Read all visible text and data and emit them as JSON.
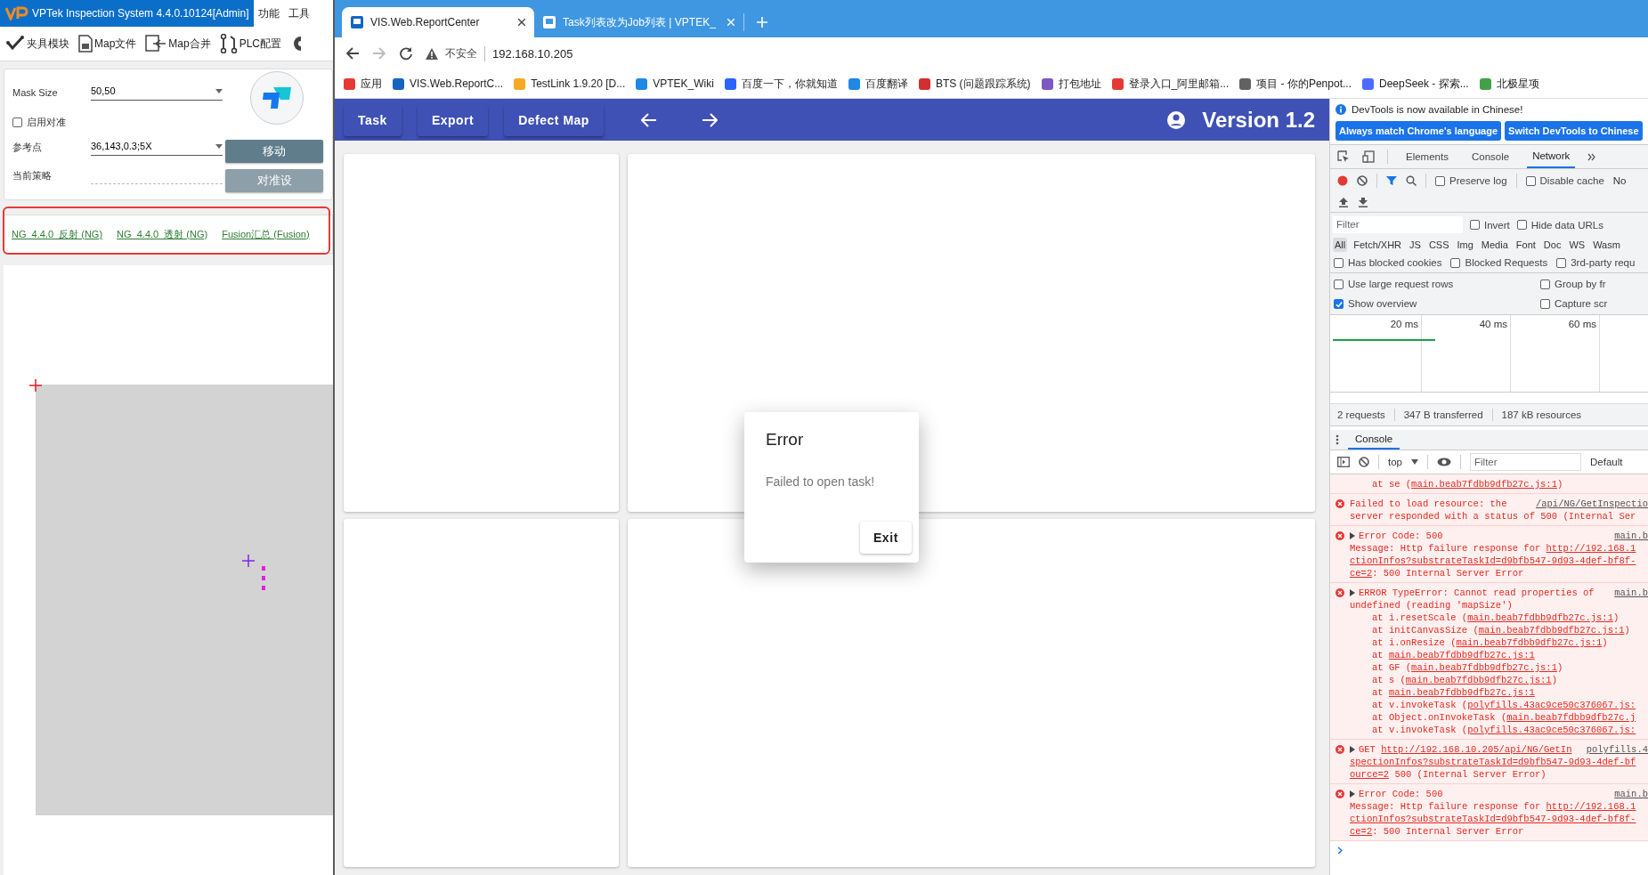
{
  "vptek_window": {
    "title": "VPTek Inspection System 4.4.0.10124[Admin]",
    "menu": [
      "功能",
      "工具"
    ],
    "toolbar": [
      "夹具模块",
      "Map文件",
      "Map合并",
      "PLC配置"
    ],
    "form": {
      "mask_size": {
        "label": "Mask Size",
        "value": "50,50"
      },
      "align": {
        "label": "启用对准",
        "checked": false
      },
      "reference": {
        "label": "参考点",
        "value": "36,143,0.3;5X"
      },
      "move_button": "移动",
      "strategy": {
        "label": "当前策略"
      },
      "align_settings": {
        "label": "对准设",
        "disabled": true
      }
    },
    "recipe_links": [
      "NG_4.4.0_反射 (NG)",
      "NG_4.4.0_透射 (NG)",
      "Fusion汇总 (Fusion)"
    ]
  },
  "browser": {
    "tabs": [
      {
        "title": "VIS.Web.ReportCenter",
        "selected": true
      },
      {
        "title": "Task列表改为Job列表 | VPTEK_",
        "selected": false
      }
    ],
    "security": "不安全",
    "url": "192.168.10.205",
    "bookmarks": [
      "应用",
      "VIS.Web.ReportC...",
      "TestLink 1.9.20 [D...",
      "VPTEK_Wiki",
      "百度一下，你就知道",
      "百度翻译",
      "BTS (问题跟踪系统)",
      "打包地址",
      "登录入口_阿里邮箱...",
      "项目 - 你的Penpot...",
      "DeepSeek - 探索...",
      "北极星项"
    ]
  },
  "report_center": {
    "nav": [
      "Task",
      "Export",
      "Defect Map"
    ],
    "version": "Version 1.2",
    "dialog": {
      "title": "Error",
      "message": "Failed to open task!",
      "button": "Exit"
    }
  },
  "devtools": {
    "notice": "DevTools is now available in Chinese!",
    "notice_buttons": [
      "Always match Chrome's language",
      "Switch DevTools to Chinese"
    ],
    "panels": [
      {
        "label": "Elements",
        "selected": false
      },
      {
        "label": "Console",
        "selected": false
      },
      {
        "label": "Network",
        "selected": true
      }
    ],
    "network": {
      "recording": true,
      "options": [
        {
          "label": "Preserve log",
          "checked": false
        },
        {
          "label": "Disable cache",
          "checked": false
        }
      ],
      "throttle": "No",
      "filter": {
        "placeholder": "Filter"
      },
      "filter_options": [
        {
          "label": "Invert",
          "checked": false
        },
        {
          "label": "Hide data URLs",
          "checked": false
        }
      ],
      "types": [
        {
          "label": "All",
          "selected": true
        },
        {
          "label": "Fetch/XHR",
          "selected": false
        },
        {
          "label": "JS",
          "selected": false
        },
        {
          "label": "CSS",
          "selected": false
        },
        {
          "label": "Img",
          "selected": false
        },
        {
          "label": "Media",
          "selected": false
        },
        {
          "label": "Font",
          "selected": false
        },
        {
          "label": "Doc",
          "selected": false
        },
        {
          "label": "WS",
          "selected": false
        },
        {
          "label": "Wasm",
          "selected": false
        }
      ],
      "blocked_options": [
        {
          "label": "Has blocked cookies",
          "checked": false
        },
        {
          "label": "Blocked Requests",
          "checked": false
        },
        {
          "label": "3rd-party requ",
          "checked": false
        }
      ],
      "settings": [
        {
          "label": "Use large request rows",
          "checked": false
        },
        {
          "label": "Group by fr",
          "checked": false
        },
        {
          "label": "Show overview",
          "checked": true
        },
        {
          "label": "Capture scr",
          "checked": false
        }
      ],
      "overview_ticks": [
        "20 ms",
        "40 ms",
        "60 ms"
      ],
      "summary": [
        "2 requests",
        "347 B transferred",
        "187 kB resources"
      ]
    },
    "drawer": {
      "tab": "Console",
      "context": "top",
      "filter": {
        "placeholder": "Filter"
      },
      "levels": "Default",
      "messages": [
        {
          "kind": "trace",
          "expandable": false,
          "lines": [
            {
              "indent": true,
              "parts": [
                {
                  "text": "at se (",
                  "link": false
                },
                {
                  "text": "main.beab7fdbb9dfb27c.js:1",
                  "link": true
                },
                {
                  "text": ")",
                  "link": false
                }
              ]
            }
          ]
        },
        {
          "kind": "error",
          "expandable": false,
          "source": "/api/NG/GetInspectio",
          "lines": [
            {
              "indent": false,
              "parts": [
                {
                  "text": "Failed to load resource: the",
                  "link": false
                }
              ]
            },
            {
              "indent": false,
              "parts": [
                {
                  "text": "server responded with a status of 500 (Internal Ser",
                  "link": false
                }
              ]
            }
          ]
        },
        {
          "kind": "error",
          "expandable": true,
          "source": "main.b",
          "lines": [
            {
              "indent": false,
              "parts": [
                {
                  "text": "Error Code: 500",
                  "link": false
                }
              ]
            },
            {
              "indent": false,
              "parts": [
                {
                  "text": "Message: Http failure response for ",
                  "link": false
                },
                {
                  "text": "http://192.168.1",
                  "link": true
                }
              ]
            },
            {
              "indent": false,
              "parts": [
                {
                  "text": "ctionInfos?substrateTaskId=d9bfb547-9d93-4def-bf8f-",
                  "link": true
                }
              ]
            },
            {
              "indent": false,
              "parts": [
                {
                  "text": "ce=2",
                  "link": true
                },
                {
                  "text": ": 500 Internal Server Error",
                  "link": false
                }
              ]
            }
          ]
        },
        {
          "kind": "error",
          "expandable": true,
          "source": "main.b",
          "lines": [
            {
              "indent": false,
              "parts": [
                {
                  "text": "ERROR TypeError: Cannot read properties of",
                  "link": false
                }
              ]
            },
            {
              "indent": false,
              "parts": [
                {
                  "text": "undefined (reading 'mapSize')",
                  "link": false
                }
              ]
            },
            {
              "indent": true,
              "parts": [
                {
                  "text": "at i.resetScale (",
                  "link": false
                },
                {
                  "text": "main.beab7fdbb9dfb27c.js:1",
                  "link": true
                },
                {
                  "text": ")",
                  "link": false
                }
              ]
            },
            {
              "indent": true,
              "parts": [
                {
                  "text": "at initCanvasSize (",
                  "link": false
                },
                {
                  "text": "main.beab7fdbb9dfb27c.js:1",
                  "link": true
                },
                {
                  "text": ")",
                  "link": false
                }
              ]
            },
            {
              "indent": true,
              "parts": [
                {
                  "text": "at i.onResize (",
                  "link": false
                },
                {
                  "text": "main.beab7fdbb9dfb27c.js:1",
                  "link": true
                },
                {
                  "text": ")",
                  "link": false
                }
              ]
            },
            {
              "indent": true,
              "parts": [
                {
                  "text": "at ",
                  "link": false
                },
                {
                  "text": "main.beab7fdbb9dfb27c.js:1",
                  "link": true
                }
              ]
            },
            {
              "indent": true,
              "parts": [
                {
                  "text": "at GF (",
                  "link": false
                },
                {
                  "text": "main.beab7fdbb9dfb27c.js:1",
                  "link": true
                },
                {
                  "text": ")",
                  "link": false
                }
              ]
            },
            {
              "indent": true,
              "parts": [
                {
                  "text": "at s (",
                  "link": false
                },
                {
                  "text": "main.beab7fdbb9dfb27c.js:1",
                  "link": true
                },
                {
                  "text": ")",
                  "link": false
                }
              ]
            },
            {
              "indent": true,
              "parts": [
                {
                  "text": "at ",
                  "link": false
                },
                {
                  "text": "main.beab7fdbb9dfb27c.js:1",
                  "link": true
                }
              ]
            },
            {
              "indent": true,
              "parts": [
                {
                  "text": "at v.invokeTask (",
                  "link": false
                },
                {
                  "text": "polyfills.43ac9ce50c376067.js:",
                  "link": true
                }
              ]
            },
            {
              "indent": true,
              "parts": [
                {
                  "text": "at Object.onInvokeTask (",
                  "link": false
                },
                {
                  "text": "main.beab7fdbb9dfb27c.j",
                  "link": true
                }
              ]
            },
            {
              "indent": true,
              "parts": [
                {
                  "text": "at v.invokeTask (",
                  "link": false
                },
                {
                  "text": "polyfills.43ac9ce50c376067.js:",
                  "link": true
                }
              ]
            }
          ]
        },
        {
          "kind": "error",
          "expandable": true,
          "source": "polyfills.4",
          "lines": [
            {
              "indent": false,
              "parts": [
                {
                  "text": "GET ",
                  "link": false
                },
                {
                  "text": "http://192.168.10.205/api/NG/GetIn",
                  "link": true
                }
              ]
            },
            {
              "indent": false,
              "parts": [
                {
                  "text": "spectionInfos?substrateTaskId=d9bfb547-9d93-4def-bf",
                  "link": true
                }
              ]
            },
            {
              "indent": false,
              "parts": [
                {
                  "text": "ource=2",
                  "link": true
                },
                {
                  "text": " 500 (Internal Server Error)",
                  "link": false
                }
              ]
            }
          ]
        },
        {
          "kind": "error",
          "expandable": true,
          "source": "main.b",
          "lines": [
            {
              "indent": false,
              "parts": [
                {
                  "text": "Error Code: 500",
                  "link": false
                }
              ]
            },
            {
              "indent": false,
              "parts": [
                {
                  "text": "Message: Http failure response for ",
                  "link": false
                },
                {
                  "text": "http://192.168.1",
                  "link": true
                }
              ]
            },
            {
              "indent": false,
              "parts": [
                {
                  "text": "ctionInfos?substrateTaskId=d9bfb547-9d93-4def-bf8f-",
                  "link": true
                }
              ]
            },
            {
              "indent": false,
              "parts": [
                {
                  "text": "ce=2",
                  "link": true
                },
                {
                  "text": ": 500 Internal Server Error",
                  "link": false
                }
              ]
            }
          ]
        }
      ]
    }
  }
}
